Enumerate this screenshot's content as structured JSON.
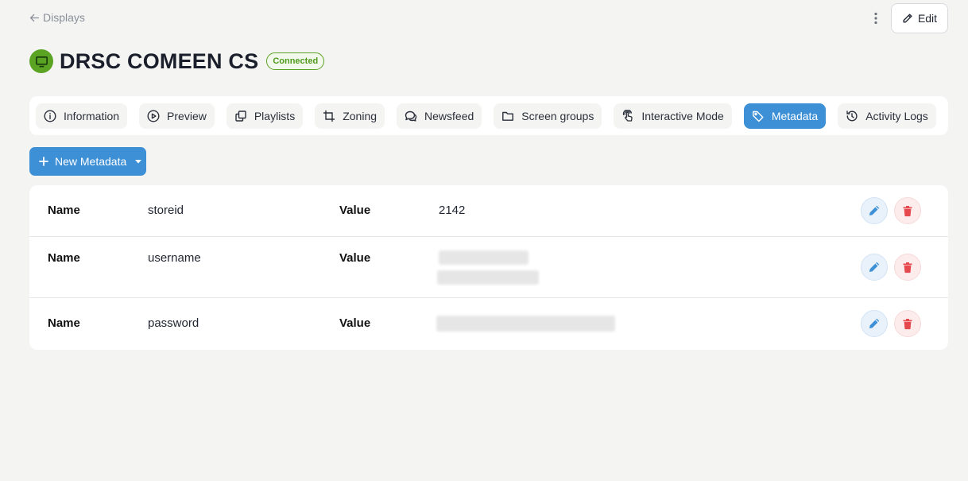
{
  "nav": {
    "back_label": "Displays"
  },
  "header": {
    "title": "DRSC COMEEN CS",
    "status": "Connected",
    "edit_label": "Edit"
  },
  "tabs": [
    {
      "label": "Information",
      "icon": "info-icon",
      "active": false
    },
    {
      "label": "Preview",
      "icon": "play-icon",
      "active": false
    },
    {
      "label": "Playlists",
      "icon": "copy-icon",
      "active": false
    },
    {
      "label": "Zoning",
      "icon": "crop-icon",
      "active": false
    },
    {
      "label": "Newsfeed",
      "icon": "chat-icon",
      "active": false
    },
    {
      "label": "Screen groups",
      "icon": "folder-icon",
      "active": false
    },
    {
      "label": "Interactive Mode",
      "icon": "touch-icon",
      "active": false
    },
    {
      "label": "Metadata",
      "icon": "tag-icon",
      "active": true
    },
    {
      "label": "Activity Logs",
      "icon": "history-icon",
      "active": false
    }
  ],
  "actions": {
    "new_metadata_label": "New Metadata"
  },
  "metadata": {
    "name_label": "Name",
    "value_label": "Value",
    "rows": [
      {
        "name": "storeid",
        "value": "2142"
      },
      {
        "name": "username",
        "value": ""
      },
      {
        "name": "password",
        "value": ""
      }
    ]
  },
  "colors": {
    "accent": "#3d8fd6",
    "status_green": "#5ba323",
    "delete_red": "#e5484d"
  }
}
